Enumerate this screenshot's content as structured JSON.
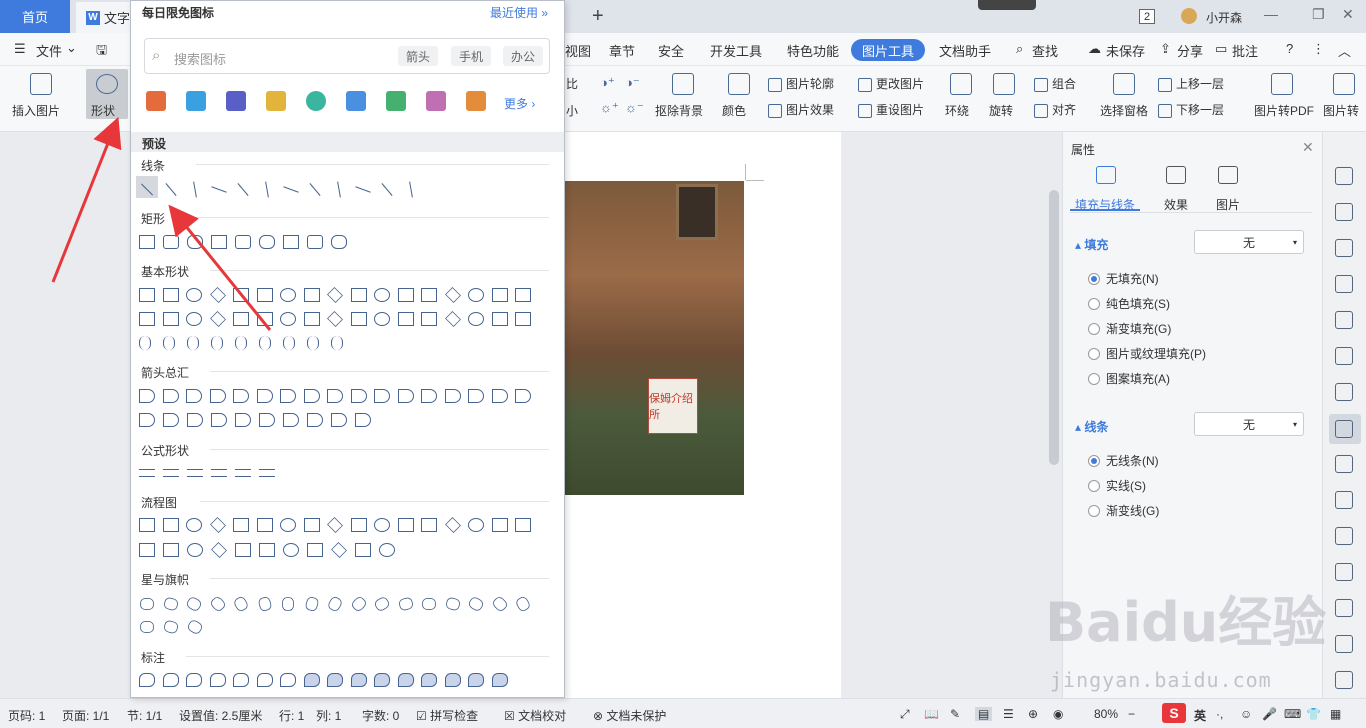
{
  "titlebar": {
    "home_tab": "首页",
    "doc_tab": "文字",
    "badge": "2",
    "user_name": "小开森"
  },
  "menubar": {
    "file": "文件",
    "items": [
      "视图",
      "章节",
      "安全",
      "开发工具",
      "特色功能",
      "图片工具",
      "文档助手",
      "查找"
    ],
    "active": "图片工具",
    "unsaved": "未保存",
    "share": "分享",
    "comment": "批注",
    "help": "?"
  },
  "ribbon": {
    "insert_picture": "插入图片",
    "shape": "形状",
    "remove_bg": "抠除背景",
    "color": "颜色",
    "pic_outline": "图片轮廓",
    "pic_effect": "图片效果",
    "change_pic": "更改图片",
    "reset_pic": "重设图片",
    "wrap": "环绕",
    "rotate": "旋转",
    "group": "组合",
    "align": "对齐",
    "select_pane": "选择窗格",
    "bring_forward": "上移一层",
    "send_backward": "下移一层",
    "to_pdf": "图片转PDF",
    "pic_more": "图片转",
    "ratio_partial": "比",
    "small_partial": "小"
  },
  "gallery": {
    "header": "每日限免图标",
    "recent": "最近使用",
    "search_placeholder": "搜索图标",
    "chips": [
      "箭头",
      "手机",
      "办公"
    ],
    "more": "更多",
    "preset": "预设",
    "categories": [
      "线条",
      "矩形",
      "基本形状",
      "箭头总汇",
      "公式形状",
      "流程图",
      "星与旗帜",
      "标注"
    ]
  },
  "panel": {
    "title": "属性",
    "tabs": [
      "填充与线条",
      "效果",
      "图片"
    ],
    "fill_section": "填充",
    "fill_value": "无",
    "fill_options": [
      "无填充(N)",
      "纯色填充(S)",
      "渐变填充(G)",
      "图片或纹理填充(P)",
      "图案填充(A)"
    ],
    "line_section": "线条",
    "line_value": "无",
    "line_options": [
      "无线条(N)",
      "实线(S)",
      "渐变线(G)"
    ]
  },
  "document": {
    "sign_text": "保姆介绍所"
  },
  "status": {
    "page_num": "页码: 1",
    "pages": "页面: 1/1",
    "section": "节: 1/1",
    "setting": "设置值: 2.5厘米",
    "row": "行: 1",
    "col": "列: 1",
    "words": "字数: 0",
    "spell": "拼写检查",
    "proof": "文档校对",
    "protect": "文档未保护",
    "zoom": "80%",
    "ime": "英"
  },
  "watermark": {
    "brand": "Baidu经验",
    "url": "jingyan.baidu.com"
  },
  "colors": {
    "accent": "#3f7bdc",
    "annotation_arrow": "#e8373a"
  }
}
